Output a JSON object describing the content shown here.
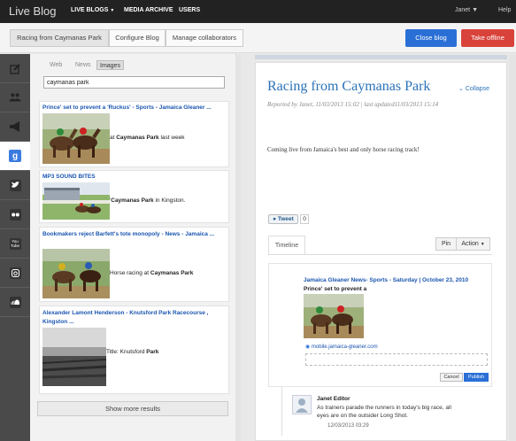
{
  "app": {
    "brand": "Live Blog"
  },
  "nav": {
    "live_blogs": "LIVE BLOGS",
    "media_archive": "MEDIA ARCHIVE",
    "users": "USERS",
    "user": "Janet",
    "help": "Help"
  },
  "subbar": {
    "tabs": [
      "Racing from Caymanas Park",
      "Configure Blog",
      "Manage collaborators"
    ],
    "close_blog": "Close blog",
    "take_offline": "Take offline"
  },
  "rail": {
    "icons": [
      "edit-icon",
      "users-icon",
      "megaphone-icon",
      "google-icon",
      "twitter-icon",
      "flickr-icon",
      "youtube-icon",
      "instagram-icon",
      "soundcloud-icon"
    ],
    "youtube_text": "You\nTube"
  },
  "media": {
    "tabs": [
      "Web",
      "News",
      "Images"
    ],
    "search_value": "caymanas park",
    "results": [
      {
        "title": "Prince' set to prevent a 'Ruckus' - Sports - Jamaica Gleaner ...",
        "desc_pre": "at ",
        "desc_bold": "Caymanas Park",
        "desc_post": " last week"
      },
      {
        "title": "MP3 SOUND BITES",
        "desc_pre": "'",
        "desc_bold": "Caymanas Park",
        "desc_post": " in Kingston."
      },
      {
        "title": "Bookmakers reject Barfett's tote monopoly - News - Jamaica ...",
        "desc_pre": "Horse racing at ",
        "desc_bold": "Caymanas Park",
        "desc_post": ""
      },
      {
        "title": "Alexander Lamont Henderson - Knutsford Park Racecourse , Kingston ...",
        "desc_pre": "Title: Knutsford ",
        "desc_bold": "Park",
        "desc_post": ""
      }
    ],
    "show_more": "Show more results"
  },
  "post": {
    "title": "Racing from Caymanas Park",
    "collapse": "Collapse",
    "meta": "Reported by Janet, 11/03/2013 15:02 | last updated11/03/2013 15:14",
    "text": "Coming live from Jamaica's best and only horse racing track!",
    "tweet": "Tweet",
    "tweet_count": "0"
  },
  "timeline": {
    "tab": "Timeline",
    "pin": "Pin",
    "action": "Action",
    "entry": {
      "title": "Jamaica Gleaner News- Sports - Saturday | October 23, 2010",
      "subtitle": "Prince' set to prevent a",
      "source": "mobile.jamaica-gleaner.com",
      "cancel": "Cancel",
      "publish": "Publish"
    },
    "comment": {
      "author": "Janet Editor",
      "text": "As trainers parade the runners in today's big race, all eyes are on the outsider Long Shot.",
      "time": "12/03/2013 03:29"
    }
  },
  "colors": {
    "accent": "#2a6fd6",
    "danger": "#d9423a",
    "link": "#1a55b0",
    "title": "#2b72b8"
  }
}
